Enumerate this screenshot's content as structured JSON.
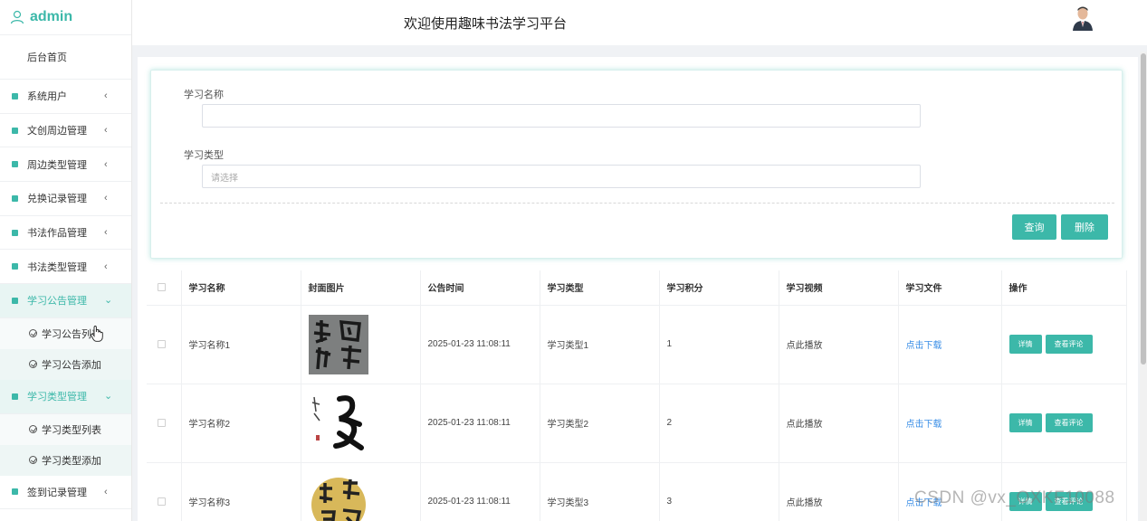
{
  "sidebar": {
    "brand": "admin",
    "home": "后台首页",
    "items": [
      {
        "label": "系统用户"
      },
      {
        "label": "文创周边管理"
      },
      {
        "label": "周边类型管理"
      },
      {
        "label": "兑换记录管理"
      },
      {
        "label": "书法作品管理"
      },
      {
        "label": "书法类型管理"
      },
      {
        "label": "学习公告管理"
      },
      {
        "label": "学习公告列表"
      },
      {
        "label": "学习公告添加"
      },
      {
        "label": "学习类型管理"
      },
      {
        "label": "学习类型列表"
      },
      {
        "label": "学习类型添加"
      },
      {
        "label": "签到记录管理"
      }
    ]
  },
  "header": {
    "title": "欢迎使用趣味书法学习平台"
  },
  "search": {
    "name_label": "学习名称",
    "name_value": "",
    "type_label": "学习类型",
    "type_placeholder": "请选择",
    "query_button": "查询",
    "delete_button": "删除"
  },
  "table": {
    "headers": [
      "学习名称",
      "封面图片",
      "公告时间",
      "学习类型",
      "学习积分",
      "学习视频",
      "学习文件",
      "操作"
    ],
    "rows": [
      {
        "name": "学习名称1",
        "time": "2025-01-23 11:08:11",
        "type": "学习类型1",
        "points": "1",
        "video": "点此播放",
        "file": "点击下载",
        "detail": "详情",
        "comments": "查看评论"
      },
      {
        "name": "学习名称2",
        "time": "2025-01-23 11:08:11",
        "type": "学习类型2",
        "points": "2",
        "video": "点此播放",
        "file": "点击下载",
        "detail": "详情",
        "comments": "查看评论"
      },
      {
        "name": "学习名称3",
        "time": "2025-01-23 11:08:11",
        "type": "学习类型3",
        "points": "3",
        "video": "点此播放",
        "file": "点击下载",
        "detail": "详情",
        "comments": "查看评论"
      }
    ]
  },
  "watermark": "CSDN @vx_OXKF10088",
  "colors": {
    "accent": "#3cb8a9",
    "link": "#3a8ee6"
  }
}
